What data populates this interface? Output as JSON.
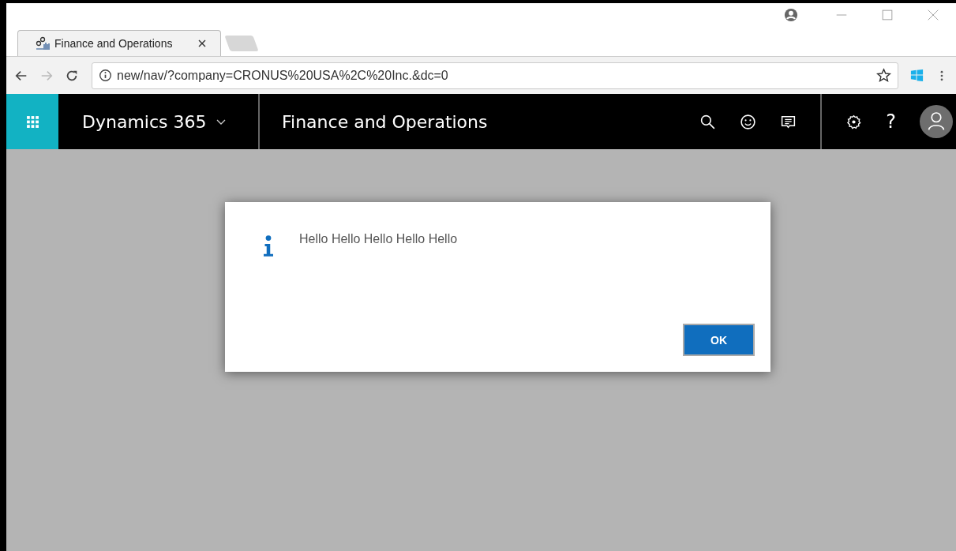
{
  "browser": {
    "tabs": [
      {
        "title": "Finance and Operations",
        "selected": true
      }
    ],
    "address": "new/nav/?company=CRONUS%20USA%2C%20Inc.&dc=0"
  },
  "app_bar": {
    "product": "Dynamics 365",
    "module": "Finance and Operations",
    "help": "?"
  },
  "dialog": {
    "message": "Hello Hello Hello Hello Hello",
    "buttons": [
      {
        "label": "OK",
        "primary": true
      }
    ]
  }
}
